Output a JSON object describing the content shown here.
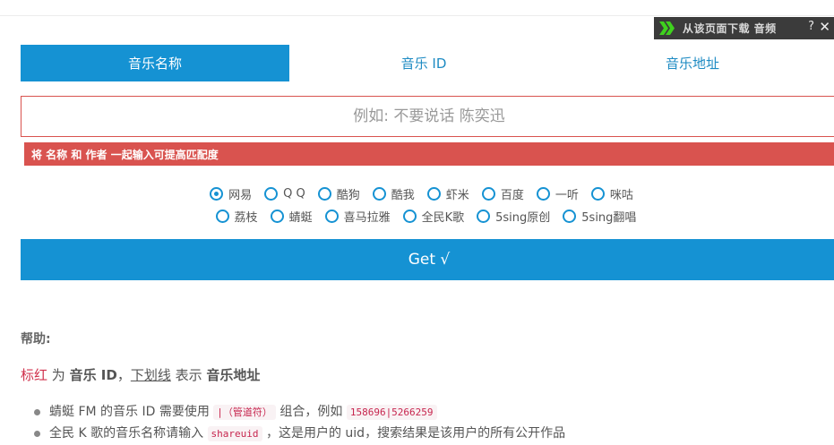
{
  "download_bar": {
    "text": "从该页面下载 音频",
    "help_label": "?",
    "close_label": "✕"
  },
  "tabs": [
    {
      "label": "音乐名称",
      "active": true
    },
    {
      "label": "音乐 ID",
      "active": false
    },
    {
      "label": "音乐地址",
      "active": false
    }
  ],
  "search": {
    "placeholder": "例如: 不要说话 陈奕迅",
    "value": ""
  },
  "alert": "将 名称 和 作者 一起输入可提高匹配度",
  "sources_row1": [
    {
      "label": "网易",
      "checked": true
    },
    {
      "label": "Q Q",
      "checked": false
    },
    {
      "label": "酷狗",
      "checked": false
    },
    {
      "label": "酷我",
      "checked": false
    },
    {
      "label": "虾米",
      "checked": false
    },
    {
      "label": "百度",
      "checked": false
    },
    {
      "label": "一听",
      "checked": false
    },
    {
      "label": "咪咕",
      "checked": false
    }
  ],
  "sources_row2": [
    {
      "label": "荔枝",
      "checked": false
    },
    {
      "label": "蜻蜓",
      "checked": false
    },
    {
      "label": "喜马拉雅",
      "checked": false
    },
    {
      "label": "全民K歌",
      "checked": false
    },
    {
      "label": "5sing原创",
      "checked": false
    },
    {
      "label": "5sing翻唱",
      "checked": false
    }
  ],
  "get_button": "Get √",
  "help": {
    "title": "帮助:",
    "legend": {
      "red": "标红",
      "t1": " 为 ",
      "b1": "音乐 ID",
      "t2": "，",
      "u": "下划线",
      "t3": " 表示 ",
      "b2": "音乐地址"
    },
    "tips": [
      {
        "pre": "蜻蜓 FM 的音乐 ID 需要使用 ",
        "code1": "|（管道符）",
        "mid": " 组合，例如 ",
        "code2": "158696|5266259",
        "post": ""
      },
      {
        "pre": "全民 K 歌的音乐名称请输入 ",
        "code1": "shareuid",
        "mid": " ，这是用户的 uid，搜索结果是该用户的所有公开作品",
        "code2": "",
        "post": ""
      }
    ]
  },
  "colors": {
    "primary": "#1592d3",
    "danger": "#d9534f",
    "code": "#c7254e"
  }
}
